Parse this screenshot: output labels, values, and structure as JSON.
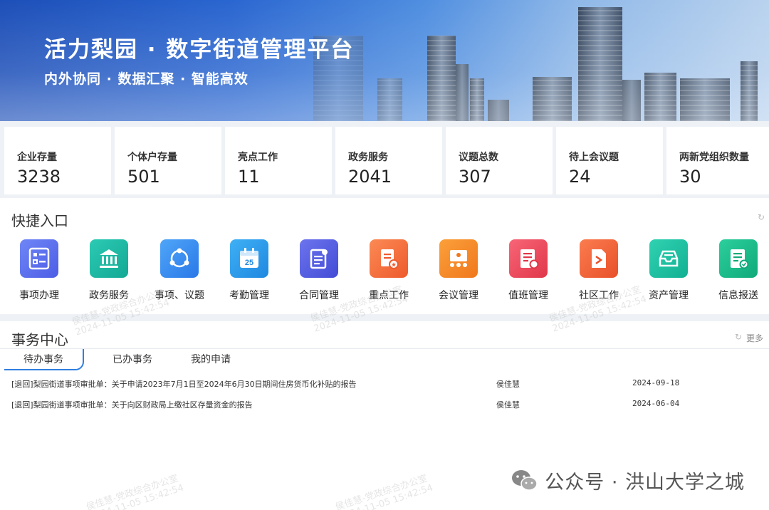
{
  "banner": {
    "title": "活力梨园 · 数字街道管理平台",
    "subtitle": "内外协同 · 数据汇聚 · 智能高效"
  },
  "stats": [
    {
      "label": "企业存量",
      "value": "3238"
    },
    {
      "label": "个体户存量",
      "value": "501"
    },
    {
      "label": "亮点工作",
      "value": "11"
    },
    {
      "label": "政务服务",
      "value": "2041"
    },
    {
      "label": "议题总数",
      "value": "307"
    },
    {
      "label": "待上会议题",
      "value": "24"
    },
    {
      "label": "两新党组织数量",
      "value": "30"
    }
  ],
  "quick": {
    "title": "快捷入口",
    "items": [
      {
        "label": "事项办理",
        "icon": "checklist-icon",
        "color": "#5a6ff0"
      },
      {
        "label": "政务服务",
        "icon": "government-building-icon",
        "color": "#1fb7a4"
      },
      {
        "label": "事项、议题",
        "icon": "share-network-icon",
        "color": "#3a8ef0"
      },
      {
        "label": "考勤管理",
        "icon": "calendar-icon",
        "color": "#2f9bea"
      },
      {
        "label": "合同管理",
        "icon": "contract-icon",
        "color": "#5560e0"
      },
      {
        "label": "重点工作",
        "icon": "key-task-icon",
        "color": "#f26a3a"
      },
      {
        "label": "会议管理",
        "icon": "meeting-icon",
        "color": "#f5892b"
      },
      {
        "label": "值班管理",
        "icon": "duty-icon",
        "color": "#ee4b5a"
      },
      {
        "label": "社区工作",
        "icon": "community-file-icon",
        "color": "#f0653a"
      },
      {
        "label": "资产管理",
        "icon": "inbox-tray-icon",
        "color": "#17bfa3"
      },
      {
        "label": "信息报送",
        "icon": "report-icon",
        "color": "#18b98a"
      }
    ]
  },
  "affairs": {
    "title": "事务中心",
    "more": "更多",
    "tabs": [
      "待办事务",
      "已办事务",
      "我的申请"
    ],
    "rows": [
      {
        "title": "[退回]梨园街道事项审批单：关于申请2023年7月1日至2024年6月30日期间住房货币化补贴的报告",
        "person": "侯佳慧",
        "date": "2024-09-18"
      },
      {
        "title": "[退回]梨园街道事项审批单：关于向区财政局上缴社区存量资金的报告",
        "person": "侯佳慧",
        "date": "2024-06-04"
      }
    ]
  },
  "watermark": {
    "name": "侯佳慧-党政综合办公室",
    "time": "2024-11-05 15:42:54"
  },
  "footer": {
    "text": "公众号 · 洪山大学之城",
    "icon": "wechat-icon"
  }
}
